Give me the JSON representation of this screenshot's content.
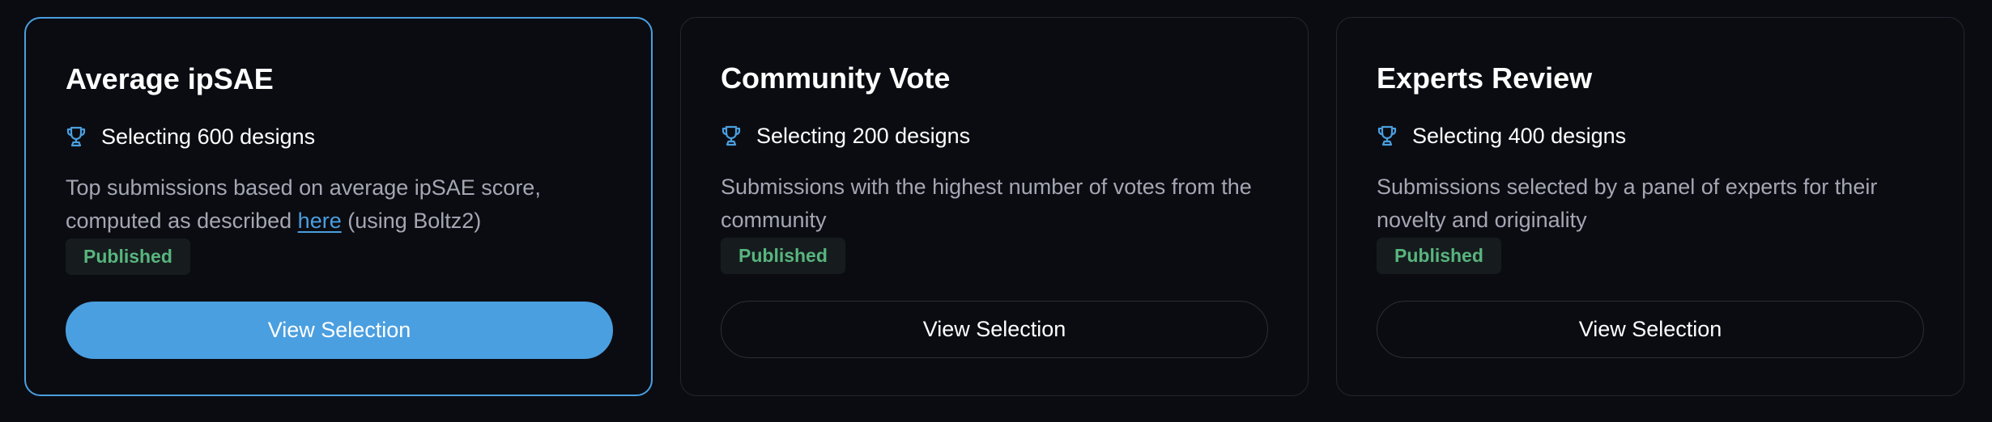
{
  "cards": [
    {
      "title": "Average ipSAE",
      "subtitle": "Selecting 600 designs",
      "description_before_link": "Top submissions based on average ipSAE score, computed as described ",
      "link_text": "here",
      "description_after_link": " (using Boltz2)",
      "status": "Published",
      "button_label": "View Selection",
      "selected": true
    },
    {
      "title": "Community Vote",
      "subtitle": "Selecting 200 designs",
      "description": "Submissions with the highest number of votes from the community",
      "status": "Published",
      "button_label": "View Selection",
      "selected": false
    },
    {
      "title": "Experts Review",
      "subtitle": "Selecting 400 designs",
      "description": "Submissions selected by a panel of experts for their novelty and originality",
      "status": "Published",
      "button_label": "View Selection",
      "selected": false
    }
  ],
  "icons": {
    "subtitle_icon": "trophy-icon"
  },
  "colors": {
    "accent": "#4a9fe0",
    "status_published": "#58b57e",
    "background": "#0b0c12",
    "card_border": "#24262f"
  }
}
